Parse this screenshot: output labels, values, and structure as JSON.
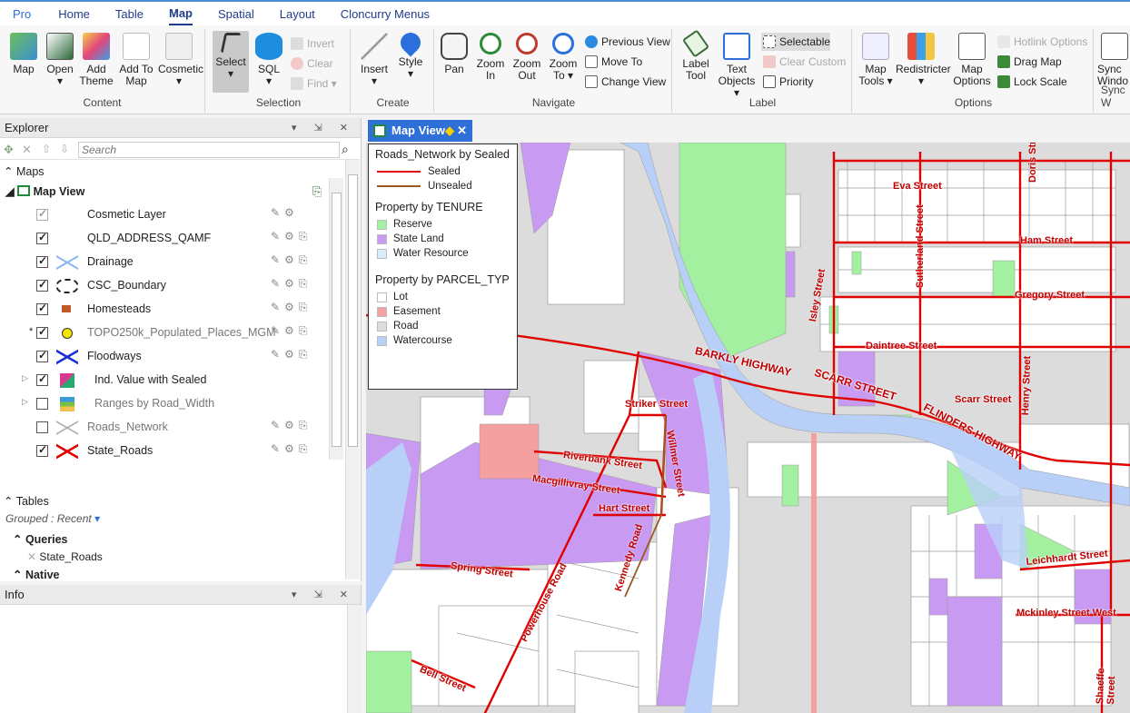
{
  "ribbon_tabs": [
    "Pro",
    "Home",
    "Table",
    "Map",
    "Spatial",
    "Layout",
    "Cloncurry Menus"
  ],
  "active_tab": "Map",
  "groups": {
    "content": {
      "label": "Content",
      "buttons": [
        "Map",
        "Open",
        "Add Theme",
        "Add To Map",
        "Cosmetic"
      ]
    },
    "selection": {
      "label": "Selection",
      "select": "Select",
      "sql": "SQL",
      "small": [
        "Invert",
        "Clear",
        "Find"
      ]
    },
    "create": {
      "label": "Create",
      "buttons": [
        "Insert",
        "Style"
      ]
    },
    "navigate": {
      "label": "Navigate",
      "buttons": [
        "Pan",
        "Zoom In",
        "Zoom Out",
        "Zoom To"
      ],
      "small": [
        "Previous View",
        "Move To",
        "Change View"
      ]
    },
    "label": {
      "label": "Label",
      "buttons": [
        "Label Tool",
        "Text Objects"
      ],
      "small": [
        "Selectable",
        "Clear Custom",
        "Priority"
      ]
    },
    "options": {
      "label": "Options",
      "buttons": [
        "Map Tools",
        "Redistricter",
        "Map Options"
      ],
      "small": [
        "Hotlink Options",
        "Drag Map",
        "Lock Scale"
      ]
    },
    "sync": {
      "label": "Sync W",
      "button": "Sync Windo"
    }
  },
  "explorer": {
    "title": "Explorer",
    "search_placeholder": "Search",
    "maps_label": "Maps",
    "map_view_label": "Map View",
    "layers": [
      {
        "name": "Cosmetic Layer",
        "checked": true
      },
      {
        "name": "QLD_ADDRESS_QAMF",
        "checked": true
      },
      {
        "name": "Drainage",
        "checked": true
      },
      {
        "name": "CSC_Boundary",
        "checked": true
      },
      {
        "name": "Homesteads",
        "checked": true
      },
      {
        "name": "TOPO250k_Populated_Places_MGM",
        "checked": true
      },
      {
        "name": "Floodways",
        "checked": true
      },
      {
        "name": "Ind. Value with Sealed",
        "checked": true
      },
      {
        "name": "Ranges by Road_Width",
        "checked": false
      },
      {
        "name": "Roads_Network",
        "checked": false
      },
      {
        "name": "State_Roads",
        "checked": true
      }
    ],
    "tables_label": "Tables",
    "grouped_label": "Grouped : Recent",
    "queries_label": "Queries",
    "query_item": "State_Roads",
    "native_label": "Native"
  },
  "info": {
    "title": "Info"
  },
  "map_tab": {
    "title": "Map View"
  },
  "legend": {
    "sections": [
      {
        "title": "Roads_Network by Sealed",
        "items": [
          {
            "label": "Sealed",
            "color": "#e00000",
            "kind": "line"
          },
          {
            "label": "Unsealed",
            "color": "#9a5a20",
            "kind": "line"
          }
        ]
      },
      {
        "title": "Property by TENURE",
        "items": [
          {
            "label": "Reserve",
            "color": "#a3f0a0"
          },
          {
            "label": "State Land",
            "color": "#c89af2"
          },
          {
            "label": "Water Resource",
            "color": "#d8eefc"
          }
        ]
      },
      {
        "title": "Property by PARCEL_TYP",
        "items": [
          {
            "label": "Lot",
            "color": "#ffffff"
          },
          {
            "label": "Easement",
            "color": "#f5a0a0"
          },
          {
            "label": "Road",
            "color": "#dcdcdc"
          },
          {
            "label": "Watercourse",
            "color": "#b8d0f8"
          }
        ]
      }
    ]
  },
  "streets": [
    "Eva Street",
    "Doris Street",
    "Ham Street",
    "Sutherland Street",
    "Isley Street",
    "Gregory Street",
    "Daintree Street",
    "BARKLY HIGHWAY",
    "SCARR STREET",
    "FLINDERS HIGHWAY",
    "Scarr Street",
    "Henry Street",
    "Striker Street",
    "Willmer Street",
    "Riverbank Street",
    "Macgillivray Street",
    "Hart Street",
    "Kennedy Road",
    "Spring Street",
    "Powerhouse Road",
    "Bell Street",
    "Leichhardt Street",
    "Mckinley Street West",
    "Shaeffe Street"
  ]
}
